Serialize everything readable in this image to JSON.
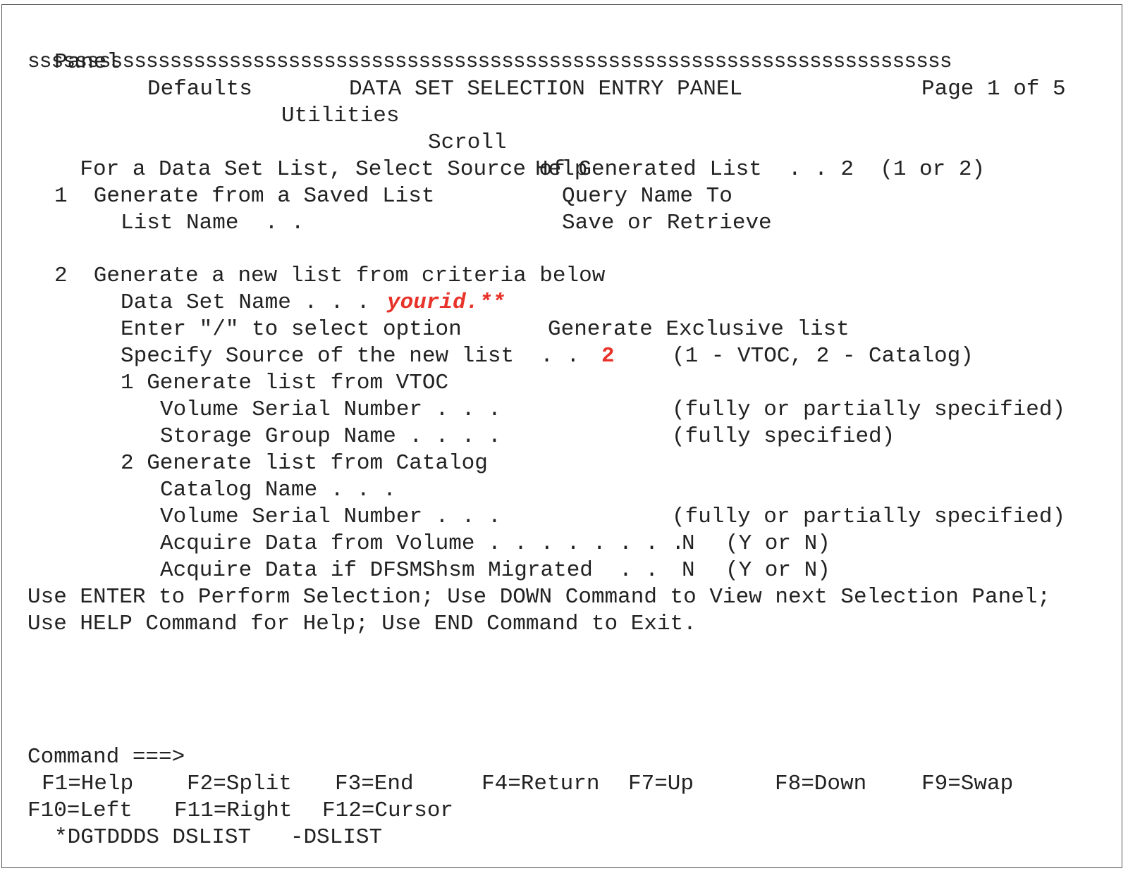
{
  "menu": [
    "Panel",
    "Defaults",
    "Utilities",
    "Scroll",
    "Help"
  ],
  "separator": "ssssssssssssssssssssssssssssssssssssssssssssssssssssssssssssssssssssssssssssss",
  "title": "DATA SET SELECTION ENTRY PANEL",
  "page_info": "Page 1 of 5",
  "source_prompt": "For a Data Set List, Select Source of Generated List  . .",
  "source_value": "2",
  "source_hint": "(1 or 2)",
  "opt1": {
    "label": "1  Generate from a Saved List",
    "list_name_label": "List Name  . .",
    "query_label_1": "Query Name To",
    "query_label_2": "Save or Retrieve"
  },
  "opt2": {
    "label": "2  Generate a new list from criteria below",
    "dsn_label": "Data Set Name . . .",
    "dsn_value": "yourid.**",
    "slash_label": "Enter \"/\" to select option",
    "exclusive_label": "Generate Exclusive list",
    "specify_label": "Specify Source of the new list  . .",
    "specify_value": "2",
    "specify_hint": "(1 - VTOC, 2 - Catalog)",
    "vtoc_label": "1 Generate list from VTOC",
    "volser_label": "Volume Serial Number . . .",
    "volser_hint": "(fully or partially specified)",
    "storgrp_label": "Storage Group Name . . . .",
    "storgrp_hint": "(fully specified)",
    "catalog_label": "2 Generate list from Catalog",
    "catname_label": "Catalog Name . . .",
    "volser2_label": "Volume Serial Number . . .",
    "volser2_hint": "(fully or partially specified)",
    "acq_vol_label": "Acquire Data from Volume . . . . . . . .",
    "acq_vol_value": "N",
    "acq_vol_hint": "(Y or N)",
    "acq_hsm_label": "Acquire Data if DFSMShsm Migrated  . .",
    "acq_hsm_value": "N",
    "acq_hsm_hint": "(Y or N)"
  },
  "instructions": [
    "Use ENTER to Perform Selection; Use DOWN Command to View next Selection Panel;",
    "Use HELP Command for Help; Use END Command to Exit."
  ],
  "command_label": "Command ===>",
  "fkeys_row1": [
    "F1=Help",
    "F2=Split",
    "F3=End",
    "F4=Return",
    "F7=Up",
    "F8=Down",
    "F9=Swap"
  ],
  "fkeys_row2": [
    "F10=Left",
    "F11=Right",
    "F12=Cursor"
  ],
  "status_line": "*DGTDDDS DSLIST   -DSLIST",
  "colors": {
    "highlight": "#e8332a",
    "text": "#222222",
    "border": "#555555"
  }
}
